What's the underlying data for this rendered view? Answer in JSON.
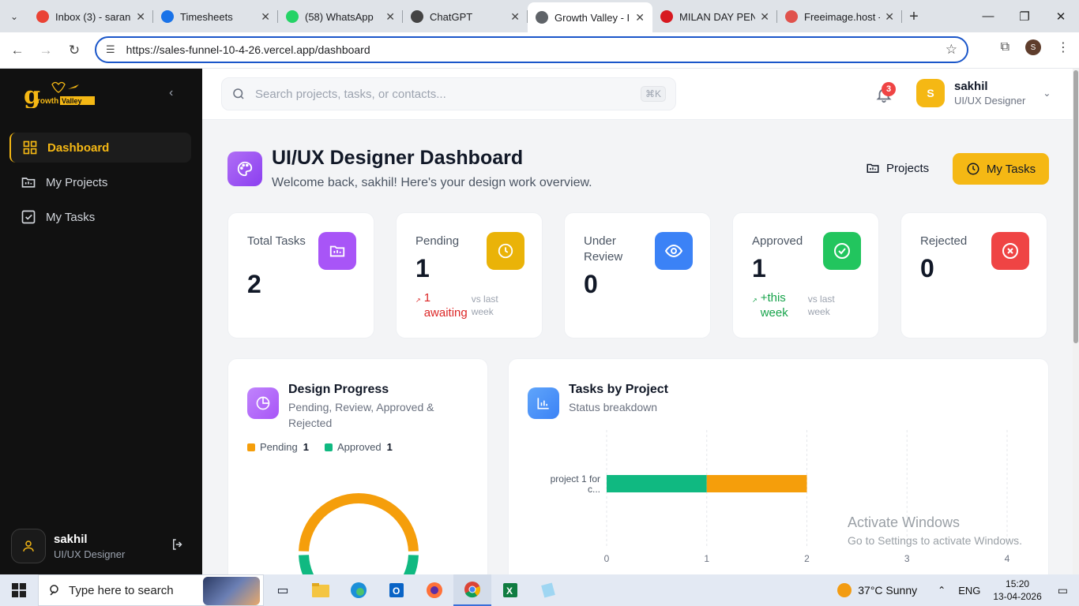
{
  "browser": {
    "tabs": [
      {
        "title": "Inbox (3) - saran",
        "favicon": "gmail-icon",
        "color": "#ea4335",
        "active": false
      },
      {
        "title": "Timesheets",
        "favicon": "timesheets-icon",
        "color": "#1a73e8",
        "active": false
      },
      {
        "title": "(58) WhatsApp",
        "favicon": "whatsapp-icon",
        "color": "#25d366",
        "active": false
      },
      {
        "title": "ChatGPT",
        "favicon": "chatgpt-icon",
        "color": "#444444",
        "active": false
      },
      {
        "title": "Growth Valley - I",
        "favicon": "globe-icon",
        "color": "#5f6368",
        "active": true
      },
      {
        "title": "MILAN DAY PEN",
        "favicon": "sm-icon",
        "color": "#d71920",
        "active": false
      },
      {
        "title": "Freeimage.host -",
        "favicon": "freeimage-icon",
        "color": "#e0524c",
        "active": false
      }
    ],
    "url": "https://sales-funnel-10-4-26.vercel.app/dashboard",
    "profile_initial": "S"
  },
  "sidebar": {
    "logo_text": "growth Valley",
    "items": [
      {
        "label": "Dashboard",
        "icon": "dashboard-grid-icon",
        "active": true
      },
      {
        "label": "My Projects",
        "icon": "folder-icon",
        "active": false
      },
      {
        "label": "My Tasks",
        "icon": "checkbox-icon",
        "active": false
      }
    ],
    "user": {
      "name": "sakhil",
      "role": "UI/UX Designer"
    }
  },
  "topbar": {
    "search_placeholder": "Search projects, tasks, or contacts...",
    "search_shortcut": "⌘K",
    "notification_count": "3",
    "user": {
      "initial": "S",
      "name": "sakhil",
      "role": "UI/UX Designer"
    }
  },
  "header": {
    "title": "UI/UX Designer Dashboard",
    "subtitle": "Welcome back, sakhil! Here's your design work overview.",
    "projects_label": "Projects",
    "tasks_label": "My Tasks"
  },
  "stats": [
    {
      "label": "Total Tasks",
      "value": "2",
      "icon": "folder-icon",
      "color": "#a855f7"
    },
    {
      "label": "Pending",
      "value": "1",
      "icon": "clock-icon",
      "color": "#eab308",
      "trend": "1 awaiting",
      "trend_color": "#dc2626",
      "trend_note": "vs last week"
    },
    {
      "label": "Under Review",
      "value": "0",
      "icon": "eye-icon",
      "color": "#3b82f6"
    },
    {
      "label": "Approved",
      "value": "1",
      "icon": "check-circle-icon",
      "color": "#22c55e",
      "trend": "+this week",
      "trend_color": "#16a34a",
      "trend_note": "vs last week"
    },
    {
      "label": "Rejected",
      "value": "0",
      "icon": "x-circle-icon",
      "color": "#ef4444"
    }
  ],
  "design_progress": {
    "title": "Design Progress",
    "subtitle": "Pending, Review, Approved & Rejected",
    "legend": [
      {
        "label": "Pending",
        "value": "1",
        "color": "#f59e0b"
      },
      {
        "label": "Approved",
        "value": "1",
        "color": "#10b981"
      }
    ]
  },
  "tasks_by_project": {
    "title": "Tasks by Project",
    "subtitle": "Status breakdown"
  },
  "chart_data": [
    {
      "type": "pie",
      "title": "Design Progress",
      "categories": [
        "Pending",
        "Approved"
      ],
      "values": [
        1,
        1
      ],
      "colors": [
        "#f59e0b",
        "#10b981"
      ]
    },
    {
      "type": "bar",
      "orientation": "horizontal",
      "stacked": true,
      "title": "Tasks by Project",
      "categories": [
        "project 1 for c..."
      ],
      "series": [
        {
          "name": "Approved",
          "values": [
            1
          ],
          "color": "#10b981"
        },
        {
          "name": "Pending",
          "values": [
            1
          ],
          "color": "#f59e0b"
        }
      ],
      "xlim": [
        0,
        4
      ],
      "xticks": [
        "0",
        "1",
        "2",
        "3",
        "4"
      ],
      "grid": true
    }
  ],
  "watermark": {
    "line1": "Activate Windows",
    "line2": "Go to Settings to activate Windows."
  },
  "taskbar": {
    "search_placeholder": "Type here to search",
    "weather": "37°C  Sunny",
    "language": "ENG",
    "time": "15:20",
    "date": "13-04-2026"
  }
}
